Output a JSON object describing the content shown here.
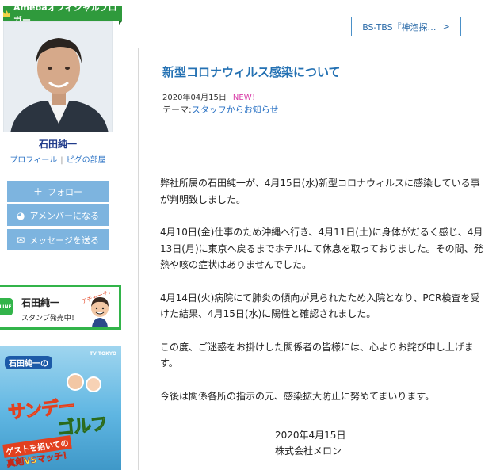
{
  "sidebar": {
    "badge": "Amebaオフィシャルブロガー",
    "blogger_name": "石田純一",
    "links": [
      "プロフィール",
      "ピグの部屋"
    ],
    "buttons": [
      {
        "icon": "plus-icon",
        "label": "フォロー"
      },
      {
        "icon": "ameba-icon",
        "label": "アメンバーになる"
      },
      {
        "icon": "mail-icon",
        "label": "メッセージを送る"
      }
    ],
    "line_banner": {
      "logo": "LINE",
      "name": "石田純一",
      "sub": "スタンプ発売中！",
      "bubble": "アチャーチ！"
    },
    "golf_banner": {
      "tv_logo": "TV TOKYO",
      "strip": "石田純一の",
      "title_1": "サンデー",
      "title_2": "ゴルフ",
      "guest": "ゲストを招いての",
      "vs": "真剣VSマッチ！"
    }
  },
  "top_button": {
    "label": "BS-TBS『神泡探…",
    "chevron": ">"
  },
  "article": {
    "title": "新型コロナウィルス感染について",
    "date": "2020年04月15日",
    "new_badge": "NEW！",
    "theme_label": "テーマ:",
    "theme_link": "スタッフからお知らせ",
    "paragraphs": [
      "弊社所属の石田純一が、4月15日(水)新型コロナウィルスに感染している事が判明致しました。",
      "4月10日(金)仕事のため沖縄へ行き、4月11日(土)に身体がだるく感じ、4月13日(月)に東京へ戻るまでホテルにて休息を取っておりました。その間、発熱や咳の症状はありませんでした。",
      "4月14日(火)病院にて肺炎の傾向が見られたため入院となり、PCR検査を受けた結果、4月15日(水)に陽性と確認されました。",
      "この度、ご迷惑をお掛けした関係者の皆様には、心よりお詫び申し上げます。",
      "今後は関係各所の指示の元、感染拡大防止に努めてまいります。"
    ],
    "sign_date": "2020年4月15日",
    "sign_company": "株式会社メロン"
  },
  "colors": {
    "ribbon": "#2f9a3c",
    "button": "#7db4df",
    "title": "#2471b3",
    "link": "#2a72c4",
    "new": "#d83aa6",
    "line": "#32b44a"
  }
}
